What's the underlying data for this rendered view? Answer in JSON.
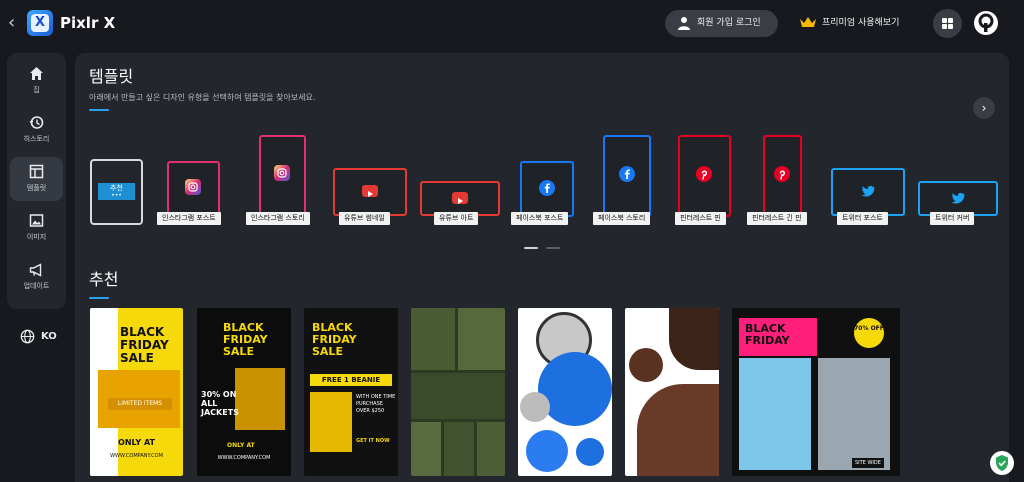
{
  "topbar": {
    "back_icon": "chevron-left-icon",
    "app_title": "Pixlr X",
    "logo_letter": "X",
    "login_label": "회원 가입 로그인",
    "premium_label": "프리미엄 사용해보기",
    "colors": {
      "bg": "#17191e",
      "button": "#3a3d44",
      "crown": "#f5b800"
    }
  },
  "sidebar": {
    "items": [
      {
        "label": "집",
        "icon": "home-icon"
      },
      {
        "label": "히스토리",
        "icon": "history-icon"
      },
      {
        "label": "템플릿",
        "icon": "template-icon",
        "active": true
      },
      {
        "label": "이미지",
        "icon": "image-icon"
      },
      {
        "label": "업데이트",
        "icon": "megaphone-icon"
      }
    ],
    "language": "KO"
  },
  "templates": {
    "title": "템플릿",
    "subtitle": "아래에서 만들고 싶은 디자인 유형을 선택하여 템플릿을 찾아보세요.",
    "recommended_card": {
      "label": "추천",
      "dots": "•••"
    },
    "items": [
      {
        "label": "인스타그램 포스트",
        "platform": "instagram"
      },
      {
        "label": "인스타그램 스토리",
        "platform": "instagram"
      },
      {
        "label": "유튜브 썸네일",
        "platform": "youtube"
      },
      {
        "label": "유튜브 아트",
        "platform": "youtube"
      },
      {
        "label": "페이스북 포스트",
        "platform": "facebook"
      },
      {
        "label": "페이스북 스토리",
        "platform": "facebook"
      },
      {
        "label": "핀터레스트 핀",
        "platform": "pinterest"
      },
      {
        "label": "핀터레스트 긴 핀",
        "platform": "pinterest"
      },
      {
        "label": "트위터 포스트",
        "platform": "twitter"
      },
      {
        "label": "트위터 커버",
        "platform": "twitter"
      }
    ],
    "colors": {
      "instagram": "#e1306c",
      "youtube": "#e53935",
      "facebook": "#1877f2",
      "pinterest": "#e60023",
      "twitter": "#1da1f2",
      "accent": "#2ba3e8"
    }
  },
  "recommended": {
    "title": "추천",
    "thumbs": [
      {
        "title": "BLACK FRIDAY SALE",
        "line1": "LIMITED ITEMS",
        "line2": "ONLY AT",
        "line3": "WWW.COMPANY.COM"
      },
      {
        "title": "BLACK FRIDAY SALE",
        "line1": "30% ON ALL JACKETS",
        "line2": "ONLY AT",
        "line3": "WWW.COMPANY.COM"
      },
      {
        "title": "BLACK FRIDAY SALE",
        "line1": "FREE 1 BEANIE",
        "line2": "WITH ONE TIME PURCHASE OVER $250",
        "line3": "GET IT NOW"
      },
      {
        "title": "",
        "line1": "",
        "line2": "",
        "line3": ""
      },
      {
        "title": "",
        "line1": "",
        "line2": "",
        "line3": ""
      },
      {
        "title": "",
        "line1": "",
        "line2": "",
        "line3": ""
      },
      {
        "title": "BLACK FRIDAY",
        "line1": "70% OFF",
        "line2": "SITE WIDE",
        "line3": ""
      }
    ]
  }
}
